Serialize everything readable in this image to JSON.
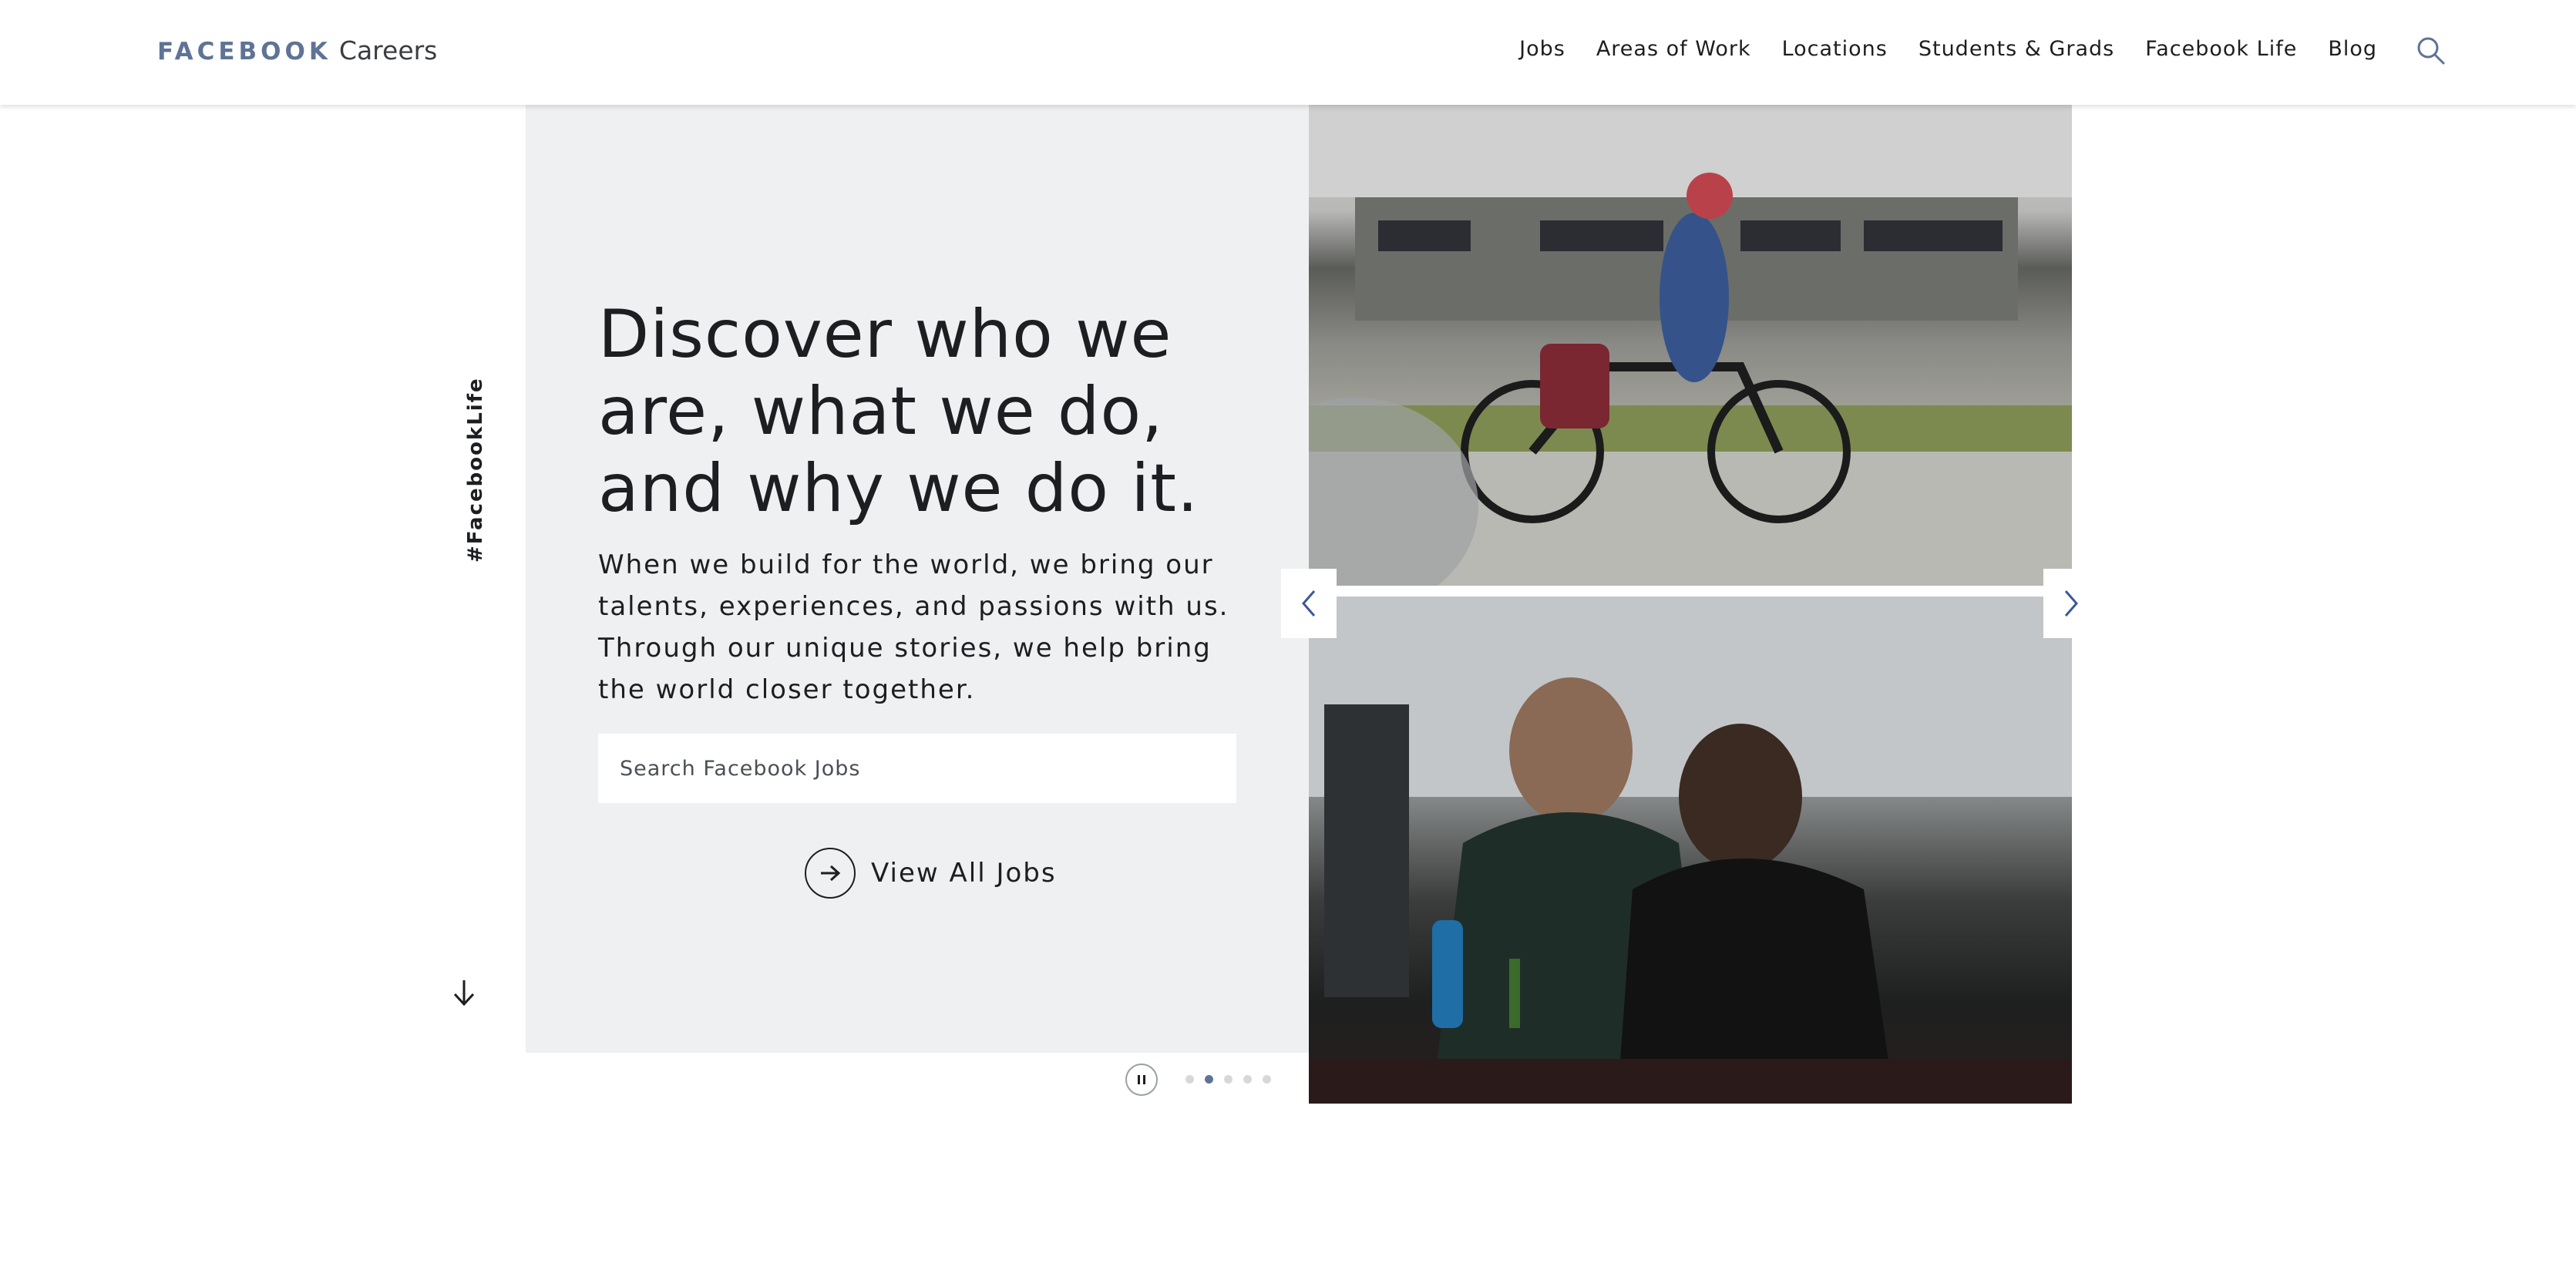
{
  "header": {
    "logo_brand": "FACEBOOK",
    "logo_sub": "Careers",
    "nav": [
      {
        "label": "Jobs"
      },
      {
        "label": "Areas of Work"
      },
      {
        "label": "Locations"
      },
      {
        "label": "Students & Grads"
      },
      {
        "label": "Facebook Life"
      },
      {
        "label": "Blog"
      }
    ],
    "search_icon": "search-icon"
  },
  "hero": {
    "tagline": "#FacebookLife",
    "headline": "Discover who we are, what we do, and why we do it.",
    "subtext": "When we build for the world, we bring our talents, experiences, and passions with us. Through our unique stories, we help bring the world closer together.",
    "search_placeholder": "Search Facebook Jobs",
    "view_all_label": "View All Jobs"
  },
  "carousel": {
    "slide_count": 5,
    "active_index": 1,
    "photos": [
      "cyclist-photo",
      "engineers-at-desk-photo"
    ]
  },
  "colors": {
    "brand": "#5e7396",
    "panel_bg": "#eff0f2",
    "text": "#1c1e21"
  }
}
